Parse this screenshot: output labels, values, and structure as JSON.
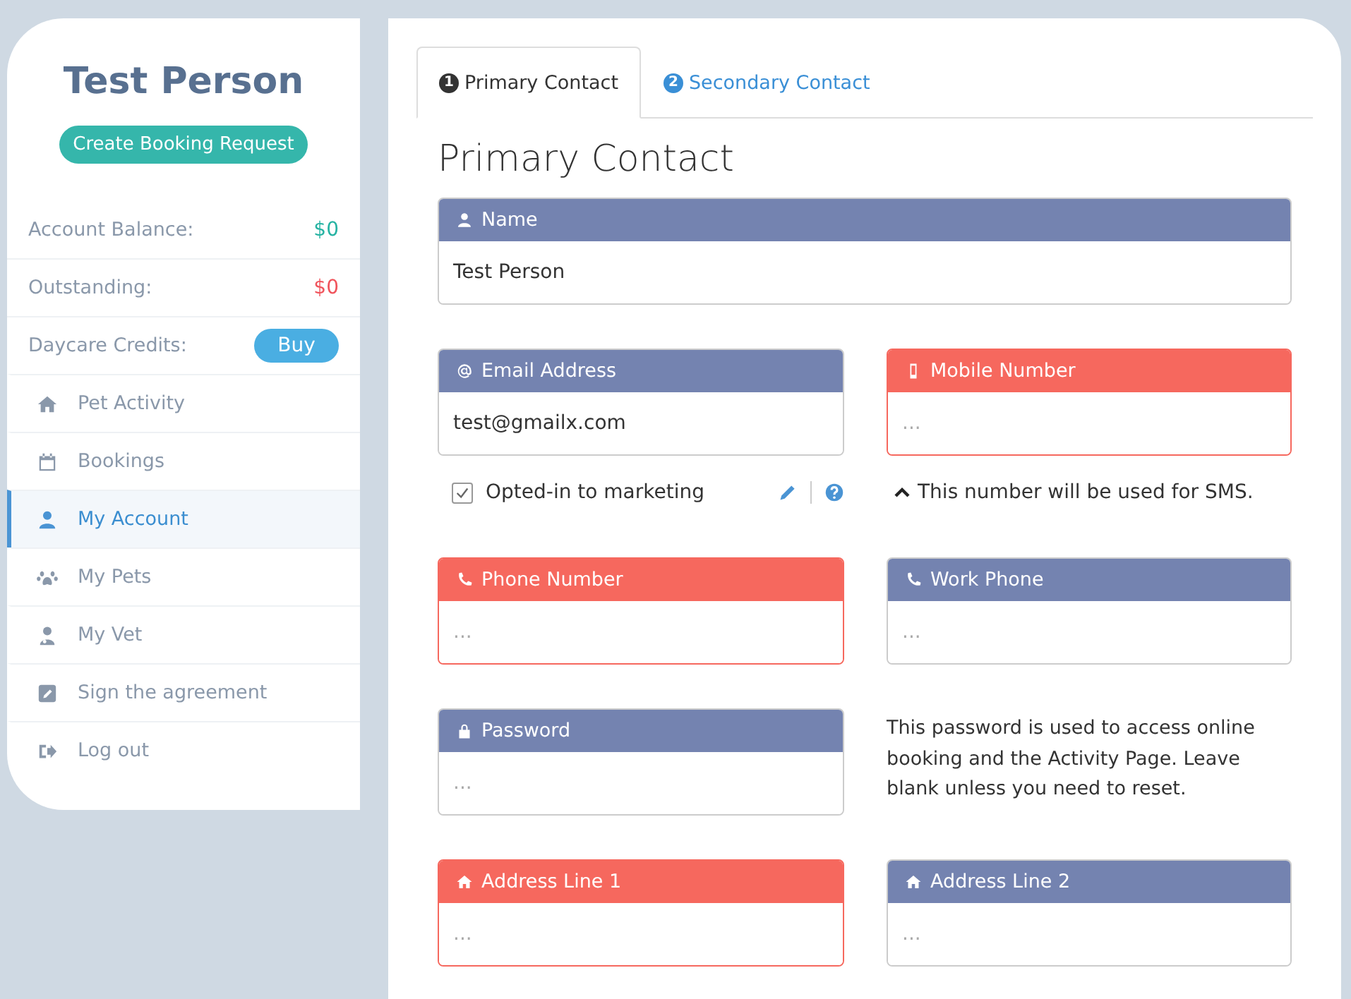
{
  "sidebar": {
    "user_name": "Test Person",
    "booking_button": "Create Booking Request",
    "stats": [
      {
        "kind": "value",
        "label": "Account Balance:",
        "value": "$0",
        "color": "#27b3a3"
      },
      {
        "kind": "value",
        "label": "Outstanding:",
        "value": "$0",
        "color": "#f0545c"
      },
      {
        "kind": "button",
        "label": "Daycare Credits:",
        "value": "Buy"
      }
    ],
    "items": [
      {
        "kind": "home",
        "label": "Pet Activity",
        "selected": false
      },
      {
        "kind": "calendar",
        "label": "Bookings",
        "selected": false
      },
      {
        "kind": "user",
        "label": "My Account",
        "selected": true
      },
      {
        "kind": "paw",
        "label": "My Pets",
        "selected": false
      },
      {
        "kind": "doctor",
        "label": "My Vet",
        "selected": false
      },
      {
        "kind": "edit",
        "label": "Sign the agreement",
        "selected": false
      },
      {
        "kind": "logout",
        "label": "Log out",
        "selected": false
      }
    ]
  },
  "tabs": [
    {
      "number": "1",
      "label": "Primary Contact",
      "selected": true
    },
    {
      "number": "2",
      "label": "Secondary Contact",
      "selected": false
    }
  ],
  "heading": "Primary Contact",
  "name_field": {
    "kind": "user",
    "label": "Name",
    "required": false,
    "value": "Test Person"
  },
  "items": [
    {
      "kind": "email",
      "label": "Email Address",
      "required": false,
      "value": "test@gmailx.com"
    },
    {
      "kind": "mobile",
      "label": "Mobile Number",
      "required": true,
      "placeholder": "..."
    },
    {
      "kind": "checkbox",
      "label": "Opted-in to marketing",
      "checked": true
    },
    {
      "kind": "hint",
      "text": "This number will be used for SMS."
    },
    {
      "kind": "phone",
      "label": "Phone Number",
      "required": true,
      "placeholder": "..."
    },
    {
      "kind": "phone",
      "label": "Work Phone",
      "required": false,
      "placeholder": "..."
    },
    {
      "kind": "password",
      "label": "Password",
      "required": false,
      "placeholder": "..."
    },
    {
      "kind": "text",
      "text": "This password is used to access online booking and the Activity Page. Leave blank unless you need to reset."
    },
    {
      "kind": "address",
      "label": "Address Line 1",
      "required": true,
      "placeholder": "..."
    },
    {
      "kind": "address",
      "label": "Address Line 2",
      "required": false,
      "placeholder": "..."
    }
  ]
}
